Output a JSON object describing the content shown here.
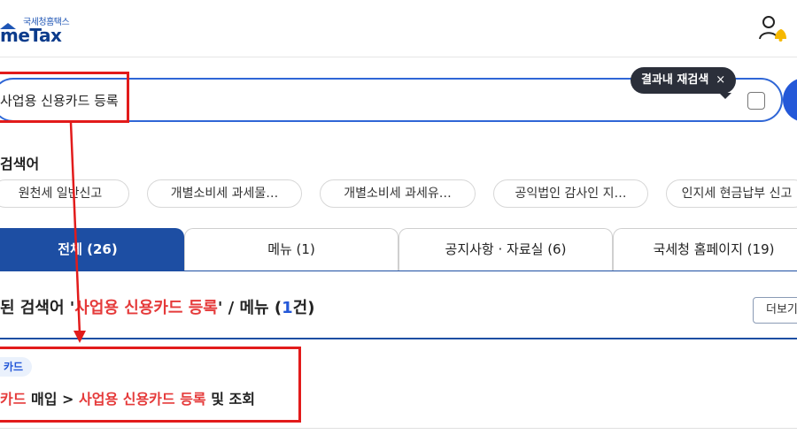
{
  "header": {
    "logo_small": "국세청홈택스",
    "logo_main": "meTax",
    "user_icon": "user-bell-icon"
  },
  "search": {
    "query": "사업용 신용카드 등록",
    "refine_tooltip": "결과내 재검색",
    "tooltip_close": "×"
  },
  "keywords": {
    "title": "검색어",
    "items": [
      "원천세 일반신고",
      "개별소비세 과세물…",
      "개별소비세 과세유…",
      "공익법인 감사인 지…",
      "인지세 현금납부 신고"
    ]
  },
  "tabs": [
    {
      "label": "전체 (26)",
      "active": true
    },
    {
      "label": "메뉴 (1)",
      "active": false
    },
    {
      "label": "공지사항 · 자료실 (6)",
      "active": false
    },
    {
      "label": "국세청 홈페이지 (19)",
      "active": false
    }
  ],
  "result": {
    "prefix": "된 검색어 '",
    "keyword": "사업용 신용카드 등록",
    "suffix": "' / 메뉴 (",
    "count": "1",
    "suffix2": "건)",
    "more": "더보기",
    "badge": "카드",
    "path_a": "카드",
    "path_b": " 매입 > ",
    "path_c": "사업용 신용카드 등록",
    "path_d": " 및 조회"
  },
  "colors": {
    "primary": "#1d4ea3",
    "accent_blue": "#2458d8",
    "highlight_red": "#e53a3a",
    "annotation_red": "#e21b1b"
  }
}
